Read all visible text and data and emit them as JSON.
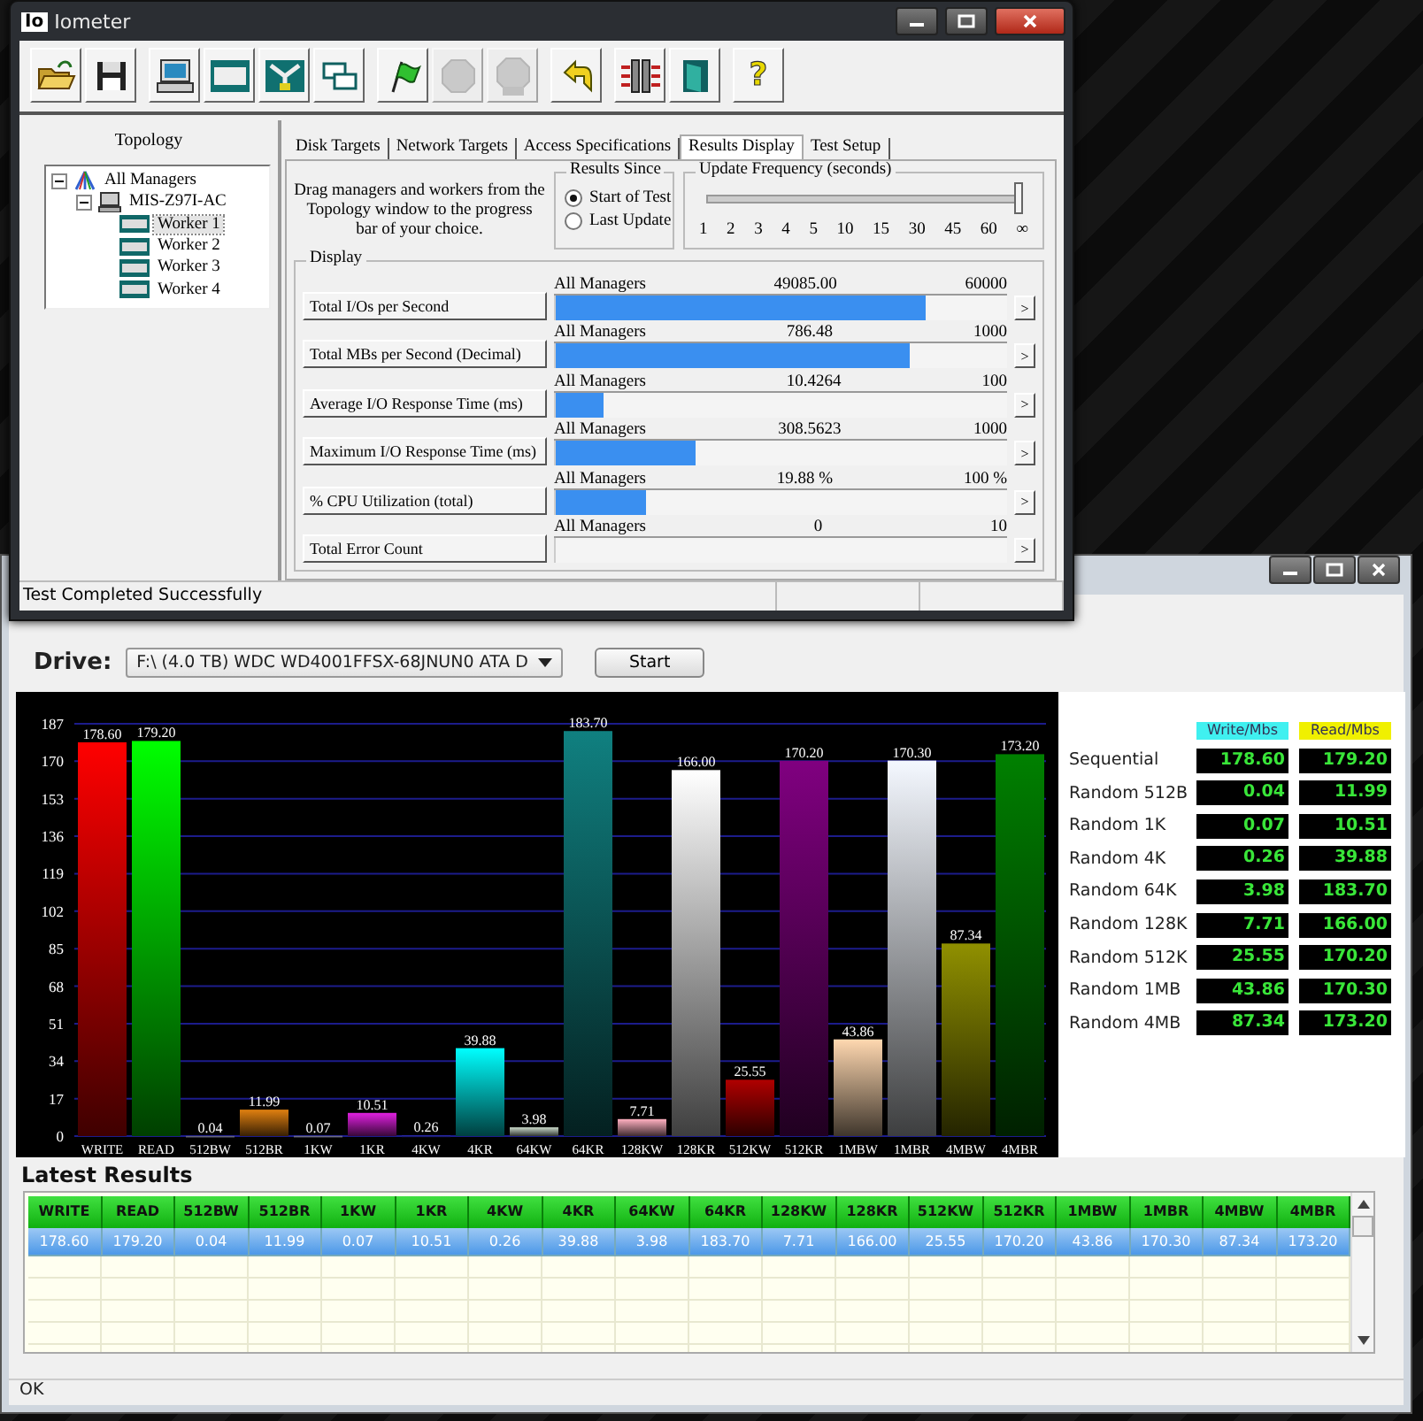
{
  "iometer_window": {
    "icon_label": "Io",
    "title": "Iometer",
    "toolbar_groups": [
      [
        {
          "kind": "open",
          "disabled": false
        },
        {
          "kind": "save",
          "disabled": false
        }
      ],
      [
        {
          "kind": "computer",
          "disabled": false
        },
        {
          "kind": "disk",
          "disabled": false
        },
        {
          "kind": "network",
          "disabled": false
        },
        {
          "kind": "copy",
          "disabled": false
        }
      ],
      [
        {
          "kind": "flag",
          "disabled": false
        },
        {
          "kind": "stop",
          "disabled": true
        },
        {
          "kind": "stop-all",
          "disabled": true
        }
      ],
      [
        {
          "kind": "reset",
          "disabled": false
        }
      ],
      [
        {
          "kind": "disconnect",
          "disabled": false
        },
        {
          "kind": "exit",
          "disabled": false
        }
      ],
      [
        {
          "kind": "help",
          "label": "?",
          "disabled": false
        }
      ]
    ],
    "topology": {
      "title": "Topology",
      "tree": [
        {
          "label": "All Managers",
          "kind": "managers",
          "expanded": true,
          "children": [
            {
              "label": "MIS-Z97I-AC",
              "kind": "computer",
              "expanded": true,
              "children": [
                {
                  "label": "Worker 1",
                  "kind": "worker",
                  "selected": true
                },
                {
                  "label": "Worker 2",
                  "kind": "worker",
                  "selected": false
                },
                {
                  "label": "Worker 3",
                  "kind": "worker",
                  "selected": false
                },
                {
                  "label": "Worker 4",
                  "kind": "worker",
                  "selected": false
                }
              ]
            }
          ]
        }
      ]
    },
    "tabs": [
      {
        "label": "Disk Targets",
        "selected": false
      },
      {
        "label": "Network Targets",
        "selected": false
      },
      {
        "label": "Access Specifications",
        "selected": false
      },
      {
        "label": "Results Display",
        "selected": true
      },
      {
        "label": "Test Setup",
        "selected": false
      }
    ],
    "hint": "Drag managers and workers from the Topology window to the progress bar of your choice.",
    "results_since": {
      "title": "Results Since",
      "options": [
        {
          "label": "Start of Test",
          "selected": true
        },
        {
          "label": "Last Update",
          "selected": false
        }
      ]
    },
    "update_frequency": {
      "title": "Update Frequency (seconds)",
      "level": 1,
      "ticks": [
        "1",
        "2",
        "3",
        "4",
        "5",
        "10",
        "15",
        "30",
        "45",
        "60",
        "∞"
      ]
    },
    "display": {
      "title": "Display",
      "rows": [
        {
          "label": "Total I/Os per Second",
          "target": "All Managers",
          "value": "49085.00",
          "max": "60000",
          "level": 0.818,
          "button": ">"
        },
        {
          "label": "Total MBs per Second (Decimal)",
          "target": "All Managers",
          "value": "786.48",
          "max": "1000",
          "level": 0.786,
          "button": ">"
        },
        {
          "label": "Average I/O Response Time (ms)",
          "target": "All Managers",
          "value": "10.4264",
          "max": "100",
          "level": 0.104,
          "button": ">"
        },
        {
          "label": "Maximum I/O Response Time (ms)",
          "target": "All Managers",
          "value": "308.5623",
          "max": "1000",
          "level": 0.309,
          "button": ">"
        },
        {
          "label": "% CPU Utilization (total)",
          "target": "All Managers",
          "value": "19.88 %",
          "max": "100 %",
          "level": 0.199,
          "button": ">"
        },
        {
          "label": "Total Error Count",
          "target": "All Managers",
          "value": "0",
          "max": "10",
          "level": 0,
          "button": ">"
        }
      ]
    },
    "status": "Test Completed Successfully"
  },
  "benchmark_window": {
    "drive_label": "Drive:",
    "drive_value": "F:\\ (4.0 TB) WDC WD4001FFSX-68JNUN0 ATA D",
    "start_button": "Start",
    "chart_data": {
      "type": "bar",
      "categories": [
        "WRITE",
        "READ",
        "512BW",
        "512BR",
        "1KW",
        "1KR",
        "4KW",
        "4KR",
        "64KW",
        "64KR",
        "128KW",
        "128KR",
        "512KW",
        "512KR",
        "1MBW",
        "1MBR",
        "4MBW",
        "4MBR"
      ],
      "values": [
        178.6,
        179.2,
        0.04,
        11.99,
        0.07,
        10.51,
        0.26,
        39.88,
        3.98,
        183.7,
        7.71,
        166.0,
        25.55,
        170.2,
        43.86,
        170.3,
        87.34,
        173.2
      ],
      "colors": [
        "#ff0000",
        "#00ff00",
        "#8080a0",
        "#e08010",
        "#9090b0",
        "#e020e0",
        "#3030c0",
        "#00ffff",
        "#c8d8c8",
        "#108080",
        "#ffb0c0",
        "#ffffff",
        "#b00000",
        "#800080",
        "#ffd8b0",
        "#f4f8ff",
        "#909000",
        "#008000"
      ],
      "value_labels": [
        "178.60",
        "179.20",
        "0.04",
        "11.99",
        "0.07",
        "10.51",
        "0.26",
        "39.88",
        "3.98",
        "183.70",
        "7.71",
        "166.00",
        "25.55",
        "170.20",
        "43.86",
        "170.30",
        "87.34",
        "173.20"
      ],
      "ylim": [
        0,
        187
      ],
      "grid": true,
      "yticks": [
        0,
        17,
        34,
        51,
        68,
        85,
        102,
        119,
        136,
        153,
        170,
        187
      ]
    },
    "summary": {
      "columns": [
        "Write/Mbs",
        "Read/Mbs"
      ],
      "rows": [
        {
          "label": "Sequential",
          "write": "178.60",
          "read": "179.20"
        },
        {
          "label": "Random 512B",
          "write": "0.04",
          "read": "11.99"
        },
        {
          "label": "Random 1K",
          "write": "0.07",
          "read": "10.51"
        },
        {
          "label": "Random 4K",
          "write": "0.26",
          "read": "39.88"
        },
        {
          "label": "Random 64K",
          "write": "3.98",
          "read": "183.70"
        },
        {
          "label": "Random 128K",
          "write": "7.71",
          "read": "166.00"
        },
        {
          "label": "Random 512K",
          "write": "25.55",
          "read": "170.20"
        },
        {
          "label": "Random 1MB",
          "write": "43.86",
          "read": "170.30"
        },
        {
          "label": "Random 4MB",
          "write": "87.34",
          "read": "173.20"
        }
      ]
    },
    "latest_results": {
      "title": "Latest Results",
      "columns": [
        "WRITE",
        "READ",
        "512BW",
        "512BR",
        "1KW",
        "1KR",
        "4KW",
        "4KR",
        "64KW",
        "64KR",
        "128KW",
        "128KR",
        "512KW",
        "512KR",
        "1MBW",
        "1MBR",
        "4MBW",
        "4MBR"
      ],
      "rows": [
        {
          "selected": true,
          "cells": [
            "178.60",
            "179.20",
            "0.04",
            "11.99",
            "0.07",
            "10.51",
            "0.26",
            "39.88",
            "3.98",
            "183.70",
            "7.71",
            "166.00",
            "25.55",
            "170.20",
            "43.86",
            "170.30",
            "87.34",
            "173.20"
          ]
        }
      ]
    },
    "status": "OK"
  }
}
